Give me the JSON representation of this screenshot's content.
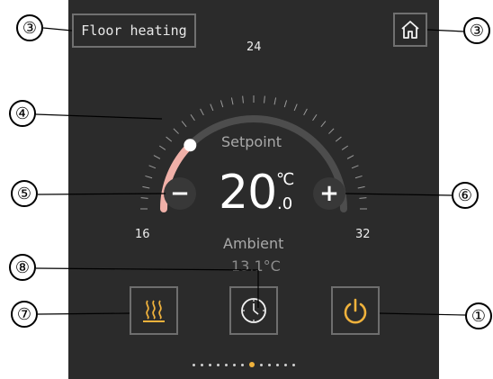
{
  "header": {
    "title": "Floor heating"
  },
  "dial": {
    "min_label": "16",
    "mid_label": "24",
    "max_label": "32",
    "min": 16,
    "max": 32,
    "setpoint_value": 20.0,
    "setpoint_label": "Setpoint",
    "setpoint_integer": "20",
    "setpoint_decimal": ".0",
    "unit": "℃",
    "ambient_label": "Ambient",
    "ambient_value": "13.1°C",
    "active_color": "#f0b0a8",
    "track_color": "#4d4d4d",
    "knob_color": "#ffffff"
  },
  "buttons": {
    "decrease_label": "−",
    "increase_label": "+",
    "accent_color": "#f0b23c"
  },
  "pager": {
    "total": 13,
    "active_index": 7
  },
  "callouts": {
    "title": "③",
    "home": "③",
    "knob": "④",
    "minus": "⑤",
    "plus": "⑥",
    "schedule": "⑧",
    "heating": "⑦",
    "power": "①"
  },
  "icons": {
    "home": "home-icon",
    "heating": "floor-heating-icon",
    "schedule": "clock-icon",
    "power": "power-icon"
  }
}
